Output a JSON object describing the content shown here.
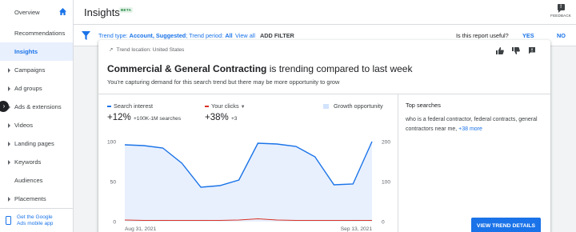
{
  "sidebar": {
    "items": [
      {
        "label": "Overview",
        "caret": false
      },
      {
        "label": "Recommendations",
        "caret": false
      },
      {
        "label": "Insights",
        "caret": false
      },
      {
        "label": "Campaigns",
        "caret": true
      },
      {
        "label": "Ad groups",
        "caret": true
      },
      {
        "label": "Ads & extensions",
        "caret": true
      },
      {
        "label": "Videos",
        "caret": true
      },
      {
        "label": "Landing pages",
        "caret": true
      },
      {
        "label": "Keywords",
        "caret": true
      },
      {
        "label": "Audiences",
        "caret": false
      },
      {
        "label": "Placements",
        "caret": true
      }
    ],
    "active_index": 2,
    "footer_line1": "Get the Google",
    "footer_line2": "Ads mobile app"
  },
  "header": {
    "title": "Insights",
    "badge": "BETA",
    "feedback_label": "FEEDBACK"
  },
  "filterbar": {
    "trend_prefix": "Trend type: ",
    "trend_value": "Account, Suggested",
    "period_prefix": "; Trend period: ",
    "period_value": "All",
    "view_all": "View all",
    "add_filter": "ADD FILTER",
    "useful_question": "Is this report useful?",
    "yes": "YES",
    "no": "NO"
  },
  "card": {
    "location": "Trend location: United States",
    "headline_bold": "Commercial & General Contracting",
    "headline_rest": " is trending compared to last week",
    "subline": "You're capturing demand for this search trend but there may be more opportunity to grow",
    "legend": {
      "search_interest": "Search interest",
      "your_clicks": "Your clicks",
      "growth": "Growth opportunity"
    },
    "metrics": {
      "search_value": "+12%",
      "search_sub": "+100K-1M searches",
      "clicks_value": "+38%",
      "clicks_sub": "+3"
    },
    "top_searches_title": "Top searches",
    "top_searches_text": "who is a federal contractor, federal contracts, general contractors near me, ",
    "top_searches_more": "+38 more",
    "cta": "VIEW TREND DETAILS"
  },
  "colors": {
    "accent": "#1a73e8",
    "clicks": "#d93025",
    "area": "#e8f0fe"
  },
  "chart_data": {
    "type": "line",
    "x": [
      "Aug 31, 2021",
      "Sep 1, 2021",
      "Sep 2, 2021",
      "Sep 3, 2021",
      "Sep 4, 2021",
      "Sep 5, 2021",
      "Sep 6, 2021",
      "Sep 7, 2021",
      "Sep 8, 2021",
      "Sep 9, 2021",
      "Sep 10, 2021",
      "Sep 11, 2021",
      "Sep 12, 2021",
      "Sep 13, 2021"
    ],
    "x_tick_labels": [
      "Aug 31, 2021",
      "Sep 13, 2021"
    ],
    "series": [
      {
        "name": "Search interest",
        "axis": "left",
        "values": [
          96,
          95,
          92,
          73,
          43,
          45,
          52,
          98,
          97,
          94,
          81,
          46,
          47,
          100
        ]
      },
      {
        "name": "Your clicks",
        "axis": "right",
        "values": [
          4,
          3,
          3,
          3,
          3,
          3,
          4,
          7,
          4,
          3,
          3,
          3,
          3,
          3
        ]
      }
    ],
    "y_left_ticks": [
      "100",
      "50",
      "0"
    ],
    "y_right_ticks": [
      "200",
      "100",
      "0"
    ],
    "ylim_left": [
      0,
      100
    ],
    "ylim_right": [
      0,
      200
    ],
    "grid": false
  }
}
